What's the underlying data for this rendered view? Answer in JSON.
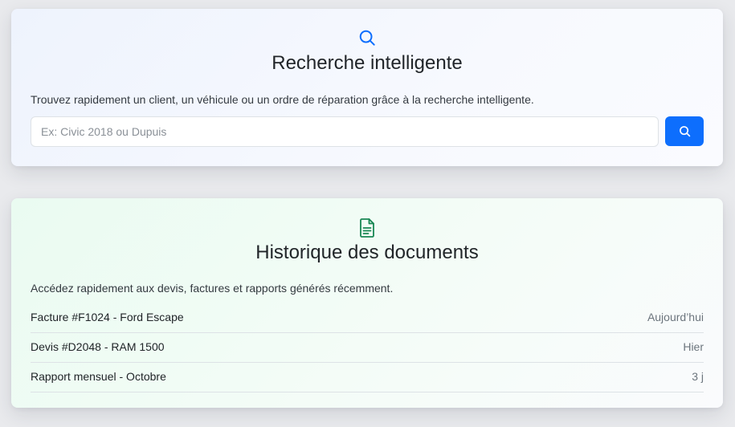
{
  "search_card": {
    "icon": "search-icon",
    "title": "Recherche intelligente",
    "description": "Trouvez rapidement un client, un véhicule ou un ordre de réparation grâce à la recherche intelligente.",
    "input_placeholder": "Ex: Civic 2018 ou Dupuis",
    "input_value": "",
    "button_icon": "search-icon"
  },
  "docs_card": {
    "icon": "file-text-icon",
    "title": "Historique des documents",
    "description": "Accédez rapidement aux devis, factures et rapports générés récemment.",
    "items": [
      {
        "name": "Facture #F1024 - Ford Escape",
        "date": "Aujourd’hui"
      },
      {
        "name": "Devis #D2048 - RAM 1500",
        "date": "Hier"
      },
      {
        "name": "Rapport mensuel - Octobre",
        "date": "3 j"
      }
    ]
  },
  "colors": {
    "primary": "#0d6efd",
    "search_icon": "#0d6efd",
    "docs_icon": "#198754"
  }
}
